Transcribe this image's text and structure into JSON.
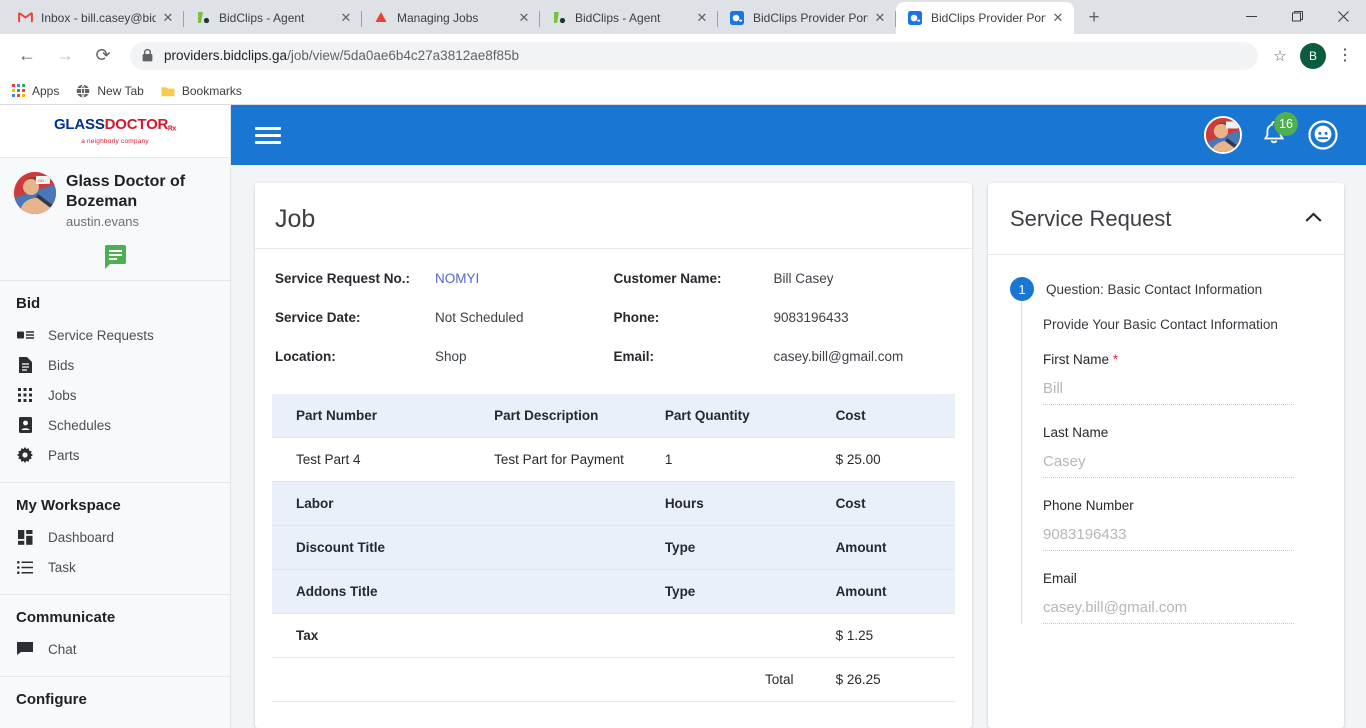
{
  "browser": {
    "tabs": [
      {
        "title": "Inbox - bill.casey@bidc",
        "favicon": "gmail-icon",
        "active": false
      },
      {
        "title": "BidClips - Agent",
        "favicon": "bidclips-icon",
        "active": false
      },
      {
        "title": "Managing Jobs",
        "favicon": "drive-icon",
        "active": false
      },
      {
        "title": "BidClips - Agent",
        "favicon": "bidclips-icon",
        "active": false
      },
      {
        "title": "BidClips Provider Portal",
        "favicon": "portal-icon",
        "active": false
      },
      {
        "title": "BidClips Provider Portal",
        "favicon": "portal-icon",
        "active": true
      }
    ],
    "new_tab_label": "+",
    "window_controls": {
      "minimize": "–",
      "maximize": "❐",
      "close": "✕"
    },
    "nav": {
      "back": "←",
      "forward": "→",
      "reload": "⟳"
    },
    "url": {
      "domain": "providers.bidclips.ga",
      "path": "/job/view/5da0ae6b4c27a3812ae8f85b"
    },
    "profile_initial": "B",
    "bookmarks": [
      {
        "label": "Apps",
        "icon": "apps-grid-icon"
      },
      {
        "label": "New Tab",
        "icon": "globe-icon"
      },
      {
        "label": "Bookmarks",
        "icon": "folder-icon"
      }
    ]
  },
  "sidebar": {
    "logo": {
      "part1": "GLASS",
      "part2": "DOCTOR",
      "mark": "ᴿˣ",
      "tagline": "a neighborly company"
    },
    "profile": {
      "name": "Glass Doctor of Bozeman",
      "username": "austin.evans"
    },
    "groups": [
      {
        "title": "Bid",
        "items": [
          {
            "label": "Service Requests",
            "icon": "service-requests-icon"
          },
          {
            "label": "Bids",
            "icon": "document-icon"
          },
          {
            "label": "Jobs",
            "icon": "grid-icon"
          },
          {
            "label": "Schedules",
            "icon": "contact-card-icon"
          },
          {
            "label": "Parts",
            "icon": "gear-icon"
          }
        ]
      },
      {
        "title": "My Workspace",
        "items": [
          {
            "label": "Dashboard",
            "icon": "dashboard-icon"
          },
          {
            "label": "Task",
            "icon": "list-icon"
          }
        ]
      },
      {
        "title": "Communicate",
        "items": [
          {
            "label": "Chat",
            "icon": "chat-icon"
          }
        ]
      },
      {
        "title": "Configure",
        "items": []
      }
    ]
  },
  "topbar": {
    "menu_icon": "hamburger-icon",
    "notification_count": "16",
    "bell_icon": "bell-icon",
    "help_icon": "face-icon"
  },
  "job": {
    "title": "Job",
    "fields_left": [
      {
        "label": "Service Request No.:",
        "value": "NOMYI",
        "is_link": true
      },
      {
        "label": "Service Date:",
        "value": "Not Scheduled",
        "is_link": false
      },
      {
        "label": "Location:",
        "value": "Shop",
        "is_link": false
      }
    ],
    "fields_right": [
      {
        "label": "Customer Name:",
        "value": "Bill Casey",
        "is_link": false
      },
      {
        "label": "Phone:",
        "value": "9083196433",
        "is_link": false
      },
      {
        "label": "Email:",
        "value": "casey.bill@gmail.com",
        "is_link": false
      }
    ],
    "table": {
      "parts_header": [
        "Part Number",
        "Part Description",
        "Part Quantity",
        "Cost"
      ],
      "parts_rows": [
        [
          "Test Part 4",
          "Test Part for Payment",
          "1",
          "$ 25.00"
        ]
      ],
      "labor_header": [
        "Labor",
        "",
        "Hours",
        "Cost"
      ],
      "discount_header": [
        "Discount Title",
        "",
        "Type",
        "Amount"
      ],
      "addons_header": [
        "Addons Title",
        "",
        "Type",
        "Amount"
      ],
      "tax_row": [
        "Tax",
        "",
        "",
        "$ 1.25"
      ],
      "total_label": "Total",
      "total_value": "$ 26.25"
    }
  },
  "service_request": {
    "title": "Service Request",
    "collapse_icon": "chevron-up-icon",
    "question_number": "1",
    "question_title": "Question: Basic Contact Information",
    "question_subtitle": "Provide Your Basic Contact Information",
    "fields": [
      {
        "label": "First Name",
        "required": true,
        "value": "Bill"
      },
      {
        "label": "Last Name",
        "required": false,
        "value": "Casey"
      },
      {
        "label": "Phone Number",
        "required": false,
        "value": "9083196433"
      },
      {
        "label": "Email",
        "required": false,
        "value": "casey.bill@gmail.com"
      }
    ]
  },
  "colors": {
    "brand_blue": "#1976d2",
    "logo_blue": "#00338d",
    "logo_red": "#d6182c",
    "badge_green": "#4caf50",
    "row_shade": "#e9f0fa",
    "link": "#5566cc",
    "required_red": "#e0354b"
  }
}
